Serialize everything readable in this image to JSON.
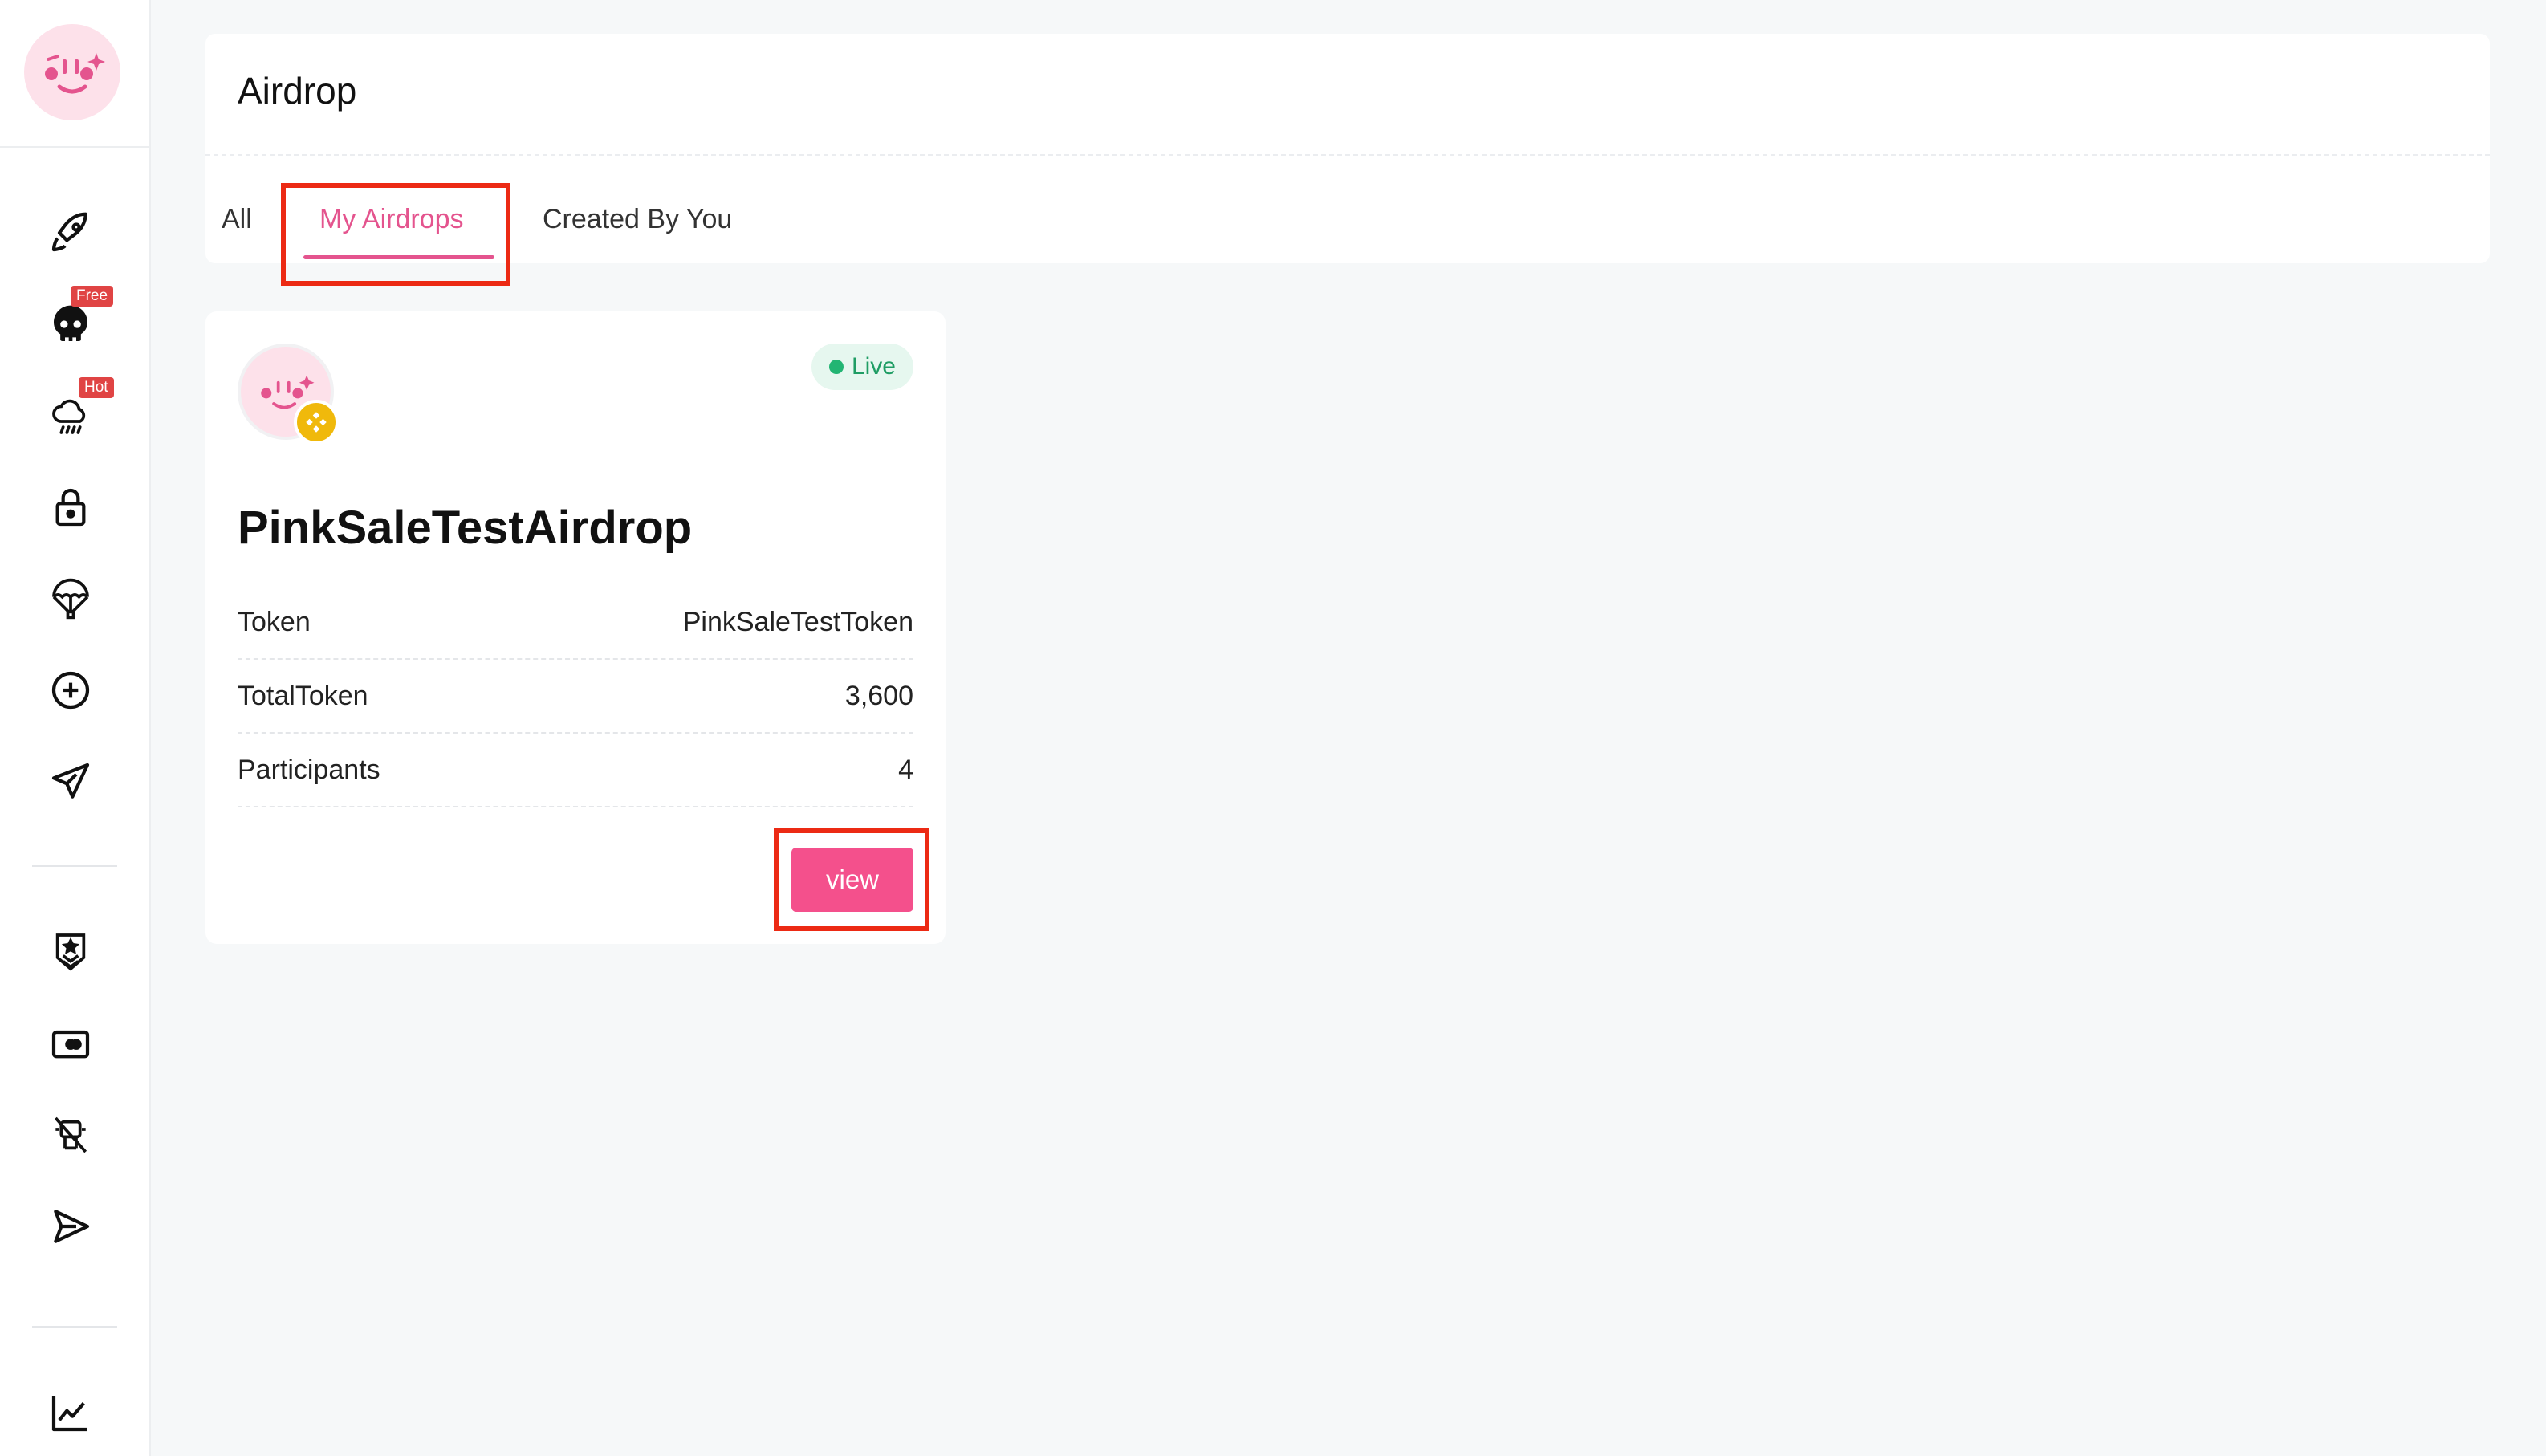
{
  "sidebar": {
    "icons": [
      {
        "name": "rocket-icon",
        "tag": ""
      },
      {
        "name": "skull-icon",
        "tag": "Free"
      },
      {
        "name": "rain-cloud-icon",
        "tag": "Hot"
      },
      {
        "name": "lock-icon",
        "tag": ""
      },
      {
        "name": "parachute-icon",
        "tag": ""
      },
      {
        "name": "plus-circle-icon",
        "tag": ""
      },
      {
        "name": "paper-plane-icon",
        "tag": ""
      },
      {
        "name": "shield-star-icon",
        "tag": ""
      },
      {
        "name": "ticket-icon",
        "tag": ""
      },
      {
        "name": "robot-off-icon",
        "tag": ""
      },
      {
        "name": "send-icon",
        "tag": ""
      },
      {
        "name": "chart-line-icon",
        "tag": ""
      }
    ],
    "tags": {
      "free": "Free",
      "hot": "Hot"
    }
  },
  "header": {
    "title": "Airdrop",
    "tabs": [
      {
        "label": "All",
        "active": false
      },
      {
        "label": "My Airdrops",
        "active": true
      },
      {
        "label": "Created By You",
        "active": false
      }
    ]
  },
  "card": {
    "status": "Live",
    "name": "PinkSaleTestAirdrop",
    "rows": [
      {
        "label": "Token",
        "value": "PinkSaleTestToken"
      },
      {
        "label": "TotalToken",
        "value": "3,600"
      },
      {
        "label": "Participants",
        "value": "4"
      }
    ],
    "button_label": "view"
  },
  "colors": {
    "accent": "#e4548e",
    "button": "#f4508c",
    "live": "#1f9d64",
    "highlight": "#ec2a14",
    "chain": "#f0b90b"
  }
}
